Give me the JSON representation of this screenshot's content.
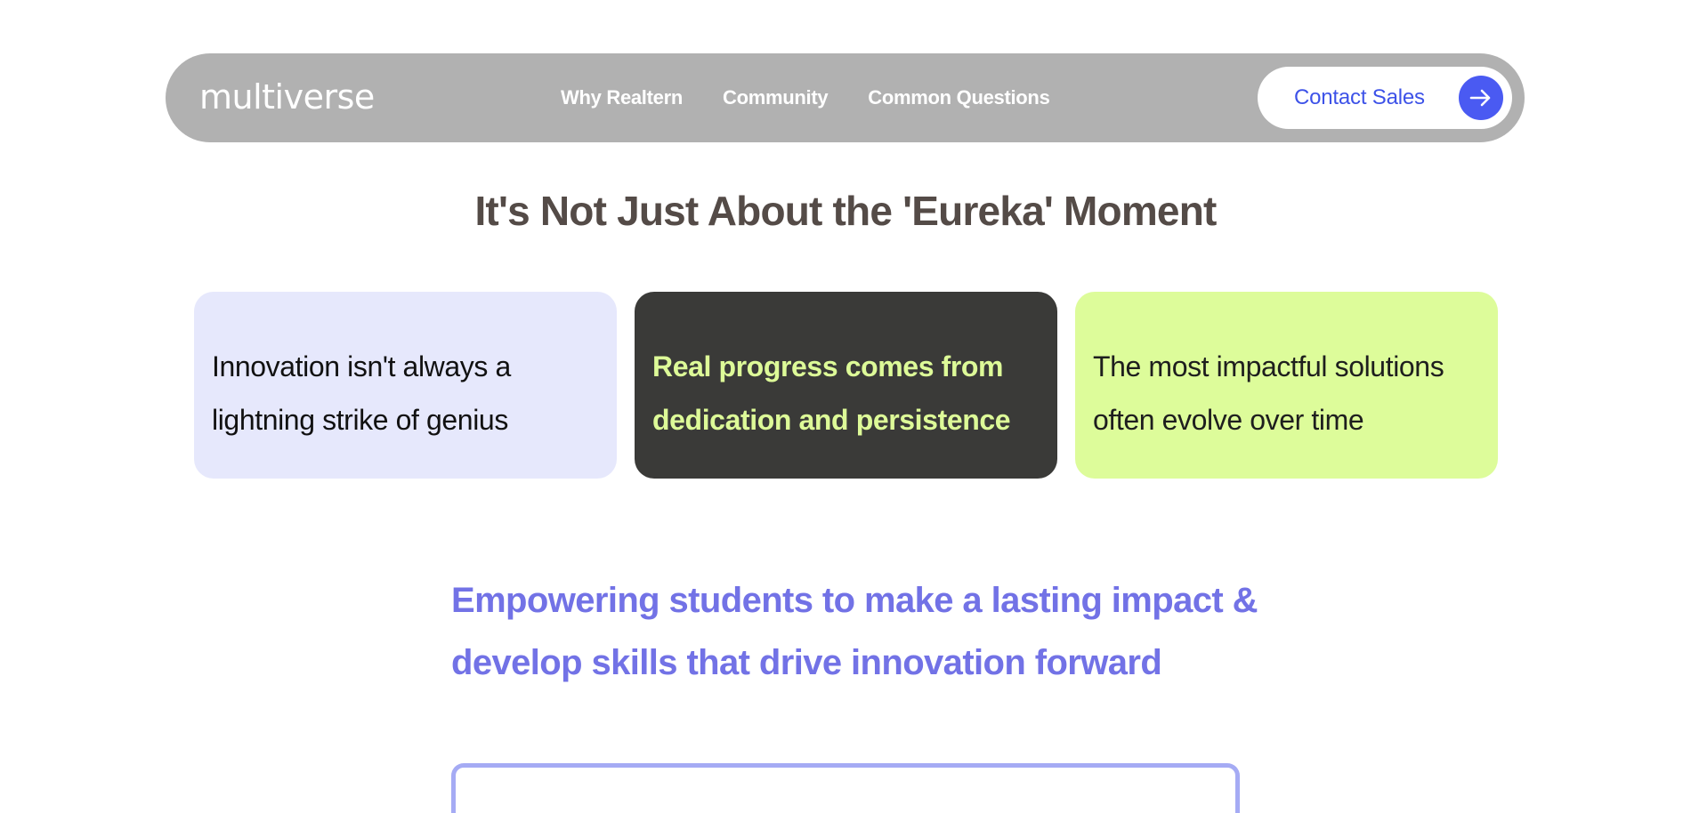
{
  "nav": {
    "logo": "multiverse",
    "links": [
      {
        "label": "Why Realtern"
      },
      {
        "label": "Community"
      },
      {
        "label": "Common Questions"
      }
    ],
    "cta_label": "Contact Sales",
    "cta_icon": "arrow-right-icon"
  },
  "headline": "It's Not Just About the 'Eureka' Moment",
  "cards": [
    {
      "line1": "Innovation isn't always a",
      "line2": "lightning strike of genius"
    },
    {
      "line1": "Real progress comes from",
      "line2": "dedication and persistence"
    },
    {
      "line1": "The most impactful solutions",
      "line2": "often evolve over time"
    }
  ],
  "empower": {
    "line1": "Empowering students to make a lasting impact &",
    "line2": "develop skills that drive innovation forward"
  },
  "colors": {
    "nav_bg": "#b1b1b1",
    "accent_blue": "#4a5af2",
    "card_lavender": "#e6e8fc",
    "card_dark": "#3a3a38",
    "card_lime": "#ddfc9a",
    "lime_text": "#ddfa98",
    "empower_text": "#7272e6",
    "input_border": "#a5abf4"
  }
}
